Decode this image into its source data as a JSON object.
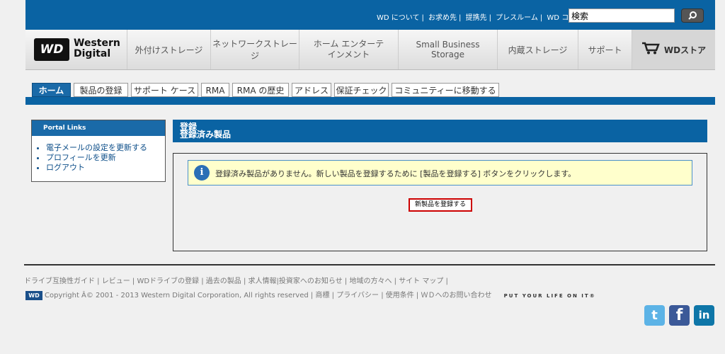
{
  "header": {
    "top_links": [
      "WD について",
      "お求め先",
      "提携先",
      "プレスルーム",
      "WD コミュニティ"
    ],
    "search_value": "検索"
  },
  "logo": {
    "mark": "WD",
    "line1": "Western",
    "line2": "Digital"
  },
  "nav": {
    "items": [
      "外付けストレージ",
      "ネットワークストレージ",
      "ホーム エンターテ\nインメント",
      "Small Business Storage",
      "内蔵ストレージ",
      "サポート"
    ],
    "store": "WDストア"
  },
  "tabs": [
    "ホーム",
    "製品の登録",
    "サポート ケース",
    "RMA",
    "RMA の歴史",
    "アドレス",
    "保証チェック",
    "コミュニティーに移動する"
  ],
  "portal": {
    "title": "Portal Links",
    "links": [
      "電子メールの設定を更新する",
      "プロフィールを更新",
      "ログアウト"
    ]
  },
  "main": {
    "title1": "登録",
    "title2": "登録済み製品",
    "info_icon": "i",
    "info_text": "登録済み製品がありません。新しい製品を登録するために [製品を登録する] ボタンをクリックします。",
    "register_button": "新製品を登録する"
  },
  "footer": {
    "links": [
      "ドライブ互換性ガイド",
      "レビュー",
      "WDドライブの登録",
      "過去の製品",
      "求人情報",
      "投資家へのお知らせ",
      "地域の方々へ",
      "サイト マップ"
    ],
    "copyright": "Copyright Â© 2001 - 2013 Western Digital Corporation, All rights reserved",
    "legal_links": [
      "商標",
      "プライバシー",
      "使用条件",
      "ＷＤへのお問い合わせ"
    ],
    "tagline": "PUT YOUR LIFE ON IT®",
    "mini_logo": "WD"
  },
  "social": {
    "twitter": "t",
    "facebook": "f",
    "linkedin": "in"
  },
  "colors": {
    "brand_blue": "#0a63a3",
    "alert_red": "#cc0000",
    "info_yellow": "#ffffcc"
  }
}
